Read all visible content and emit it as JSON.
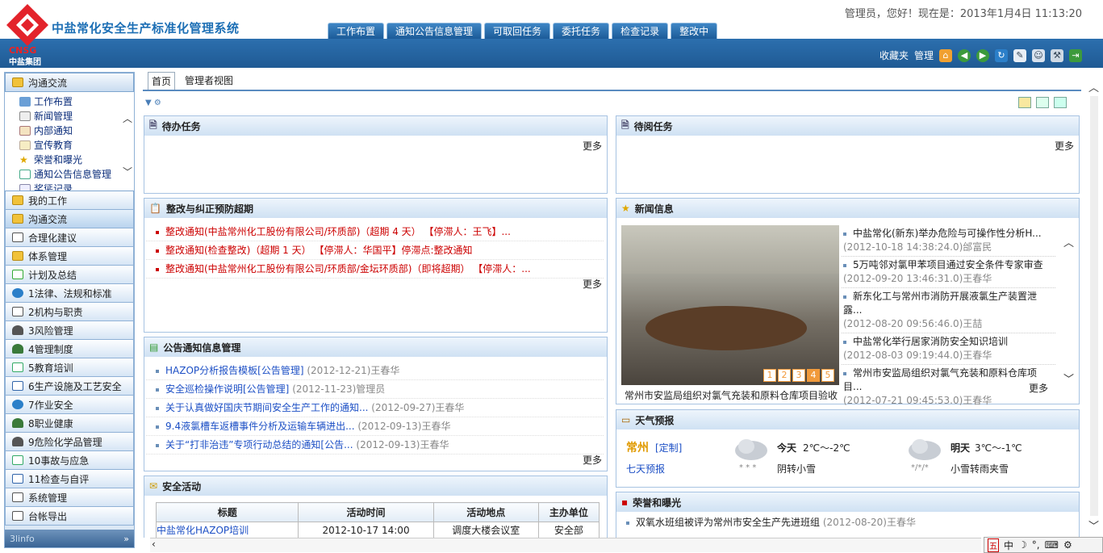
{
  "header": {
    "logo_text": "CNSG",
    "logo_group": "中盐集团",
    "system_title": "中盐常化安全生产标准化管理系统",
    "greeting": "管理员，您好！现在是：2013年1月4日  11:13:20",
    "tabs": [
      "工作布置",
      "通知公告信息管理",
      "可取回任务",
      "委托任务",
      "检查记录",
      "整改中"
    ],
    "toolbar": {
      "favorites": "收藏夹",
      "manage": "管理"
    }
  },
  "sidebar": {
    "header_label": "沟通交流",
    "sub_items": [
      "工作布置",
      "新闻管理",
      "内部通知",
      "宣传教育",
      "荣誉和曝光",
      "通知公告信息管理",
      "奖惩记录"
    ],
    "nav_items": [
      "我的工作",
      "沟通交流",
      "合理化建议",
      "体系管理",
      "计划及总结",
      "1法律、法规和标准",
      "2机构与职责",
      "3风险管理",
      "4管理制度",
      "5教育培训",
      "6生产设施及工艺安全",
      "7作业安全",
      "8职业健康",
      "9危险化学品管理",
      "10事故与应急",
      "11检查与自评",
      "系统管理",
      "台帐导出"
    ],
    "footer_text": "3linfo"
  },
  "main": {
    "tabs": [
      "首页",
      "管理者视图"
    ],
    "more": "更多",
    "todo": {
      "title": "待办任务"
    },
    "toread": {
      "title": "待阅任务"
    },
    "rectify": {
      "title": "整改与纠正预防超期",
      "rows": [
        "整改通知(中盐常州化工股份有限公司/环质部)（超期 4 天） 【停滞人：王飞】...",
        "整改通知(检查整改)（超期 1 天） 【停滞人：华国平】停滞点:整改通知",
        "整改通知(中盐常州化工股份有限公司/环质部/金坛环质部)（即将超期） 【停滞人：..."
      ]
    },
    "notice": {
      "title": "公告通知信息管理",
      "rows": [
        {
          "title": "HAZOP分析报告模板[公告管理]",
          "meta": "(2012-12-21)王春华"
        },
        {
          "title": "安全巡检操作说明[公告管理]",
          "meta": "(2012-11-23)管理员"
        },
        {
          "title": "关于认真做好国庆节期间安全生产工作的通知...",
          "meta": "(2012-09-27)王春华"
        },
        {
          "title": "9.4液氯槽车返槽事件分析及运输车辆进出...",
          "meta": "(2012-09-13)王春华"
        },
        {
          "title": "关于“打非治违”专项行动总结的通知[公告...",
          "meta": "(2012-09-13)王春华"
        }
      ]
    },
    "activity": {
      "title": "安全活动",
      "headers": [
        "标题",
        "活动时间",
        "活动地点",
        "主办单位"
      ],
      "rows": [
        [
          "中盐常化HAZOP培训",
          "2012-10-17 14:00",
          "调度大楼会议室",
          "安全部"
        ]
      ]
    },
    "news": {
      "title": "新闻信息",
      "caption": "常州市安监局组织对氯气充装和原料仓库项目验收",
      "pages": [
        "1",
        "2",
        "3",
        "4",
        "5"
      ],
      "active_page": "4",
      "items": [
        {
          "title": "中盐常化(新东)举办危险与可操作性分析H...",
          "meta": "(2012-10-18 14:38:24.0)",
          "author": "邰富民"
        },
        {
          "title": "5万吨邻对氯甲苯项目通过安全条件专家审查",
          "meta": "(2012-09-20 13:46:31.0)",
          "author": "王春华"
        },
        {
          "title": "新东化工与常州市消防开展液氯生产装置泄露...",
          "meta": "(2012-08-20 09:56:46.0)",
          "author": "王喆"
        },
        {
          "title": "中盐常化举行居家消防安全知识培训",
          "meta": "(2012-08-03 09:19:44.0)",
          "author": "王春华"
        },
        {
          "title": "常州市安监局组织对氯气充装和原料仓库项目...",
          "meta": "(2012-07-21 09:45:53.0)",
          "author": "王春华"
        }
      ]
    },
    "weather": {
      "title": "天气预报",
      "city": "常州",
      "customize": "[定制]",
      "seven_day": "七天预报",
      "today_label": "今天",
      "today_temp": "2℃～-2℃",
      "today_desc": "阴转小雪",
      "tomorrow_label": "明天",
      "tomorrow_temp": "3℃～-1℃",
      "tomorrow_desc": "小雪转雨夹雪"
    },
    "honor": {
      "title": "荣誉和曝光",
      "rows": [
        {
          "title": "双氧水班组被评为常州市安全生产先进班组",
          "meta": "(2012-08-20)王春华"
        }
      ]
    }
  },
  "statusbar": {
    "ime": "中"
  },
  "colors": {
    "brand_blue": "#1f5a94",
    "alert_red": "#cc0000",
    "link_blue": "#1c4fc5"
  }
}
